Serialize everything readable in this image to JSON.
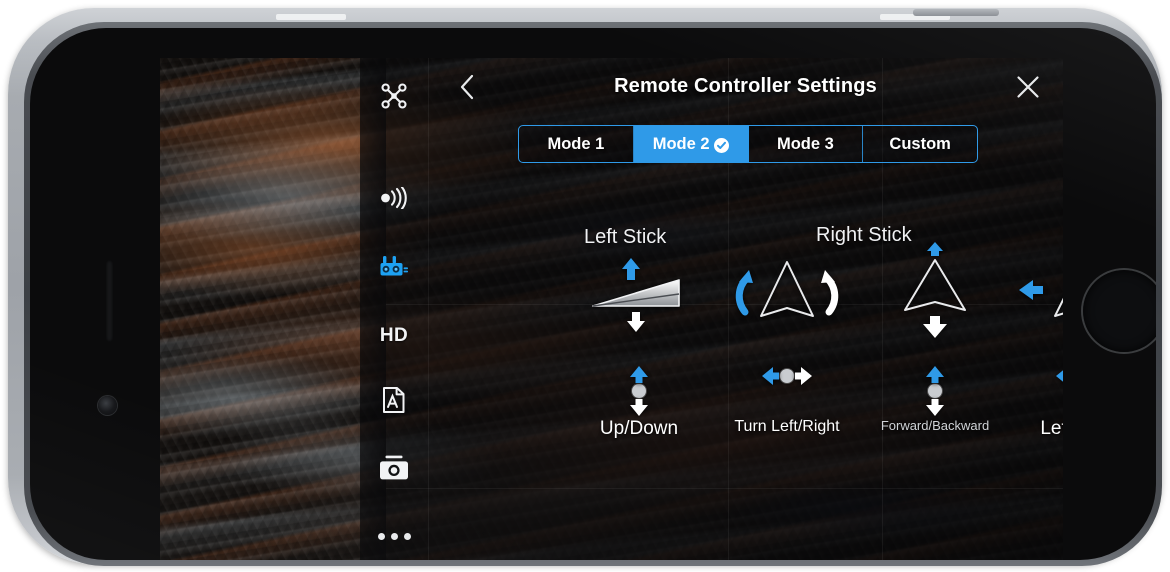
{
  "device": {
    "type": "smartphone",
    "orientation": "landscape"
  },
  "app": {
    "header": {
      "title": "Remote Controller Settings",
      "back_icon": "chevron-left-icon",
      "close_icon": "close-x-icon"
    },
    "sidebar": {
      "items": [
        {
          "id": "aircraft",
          "icon": "drone-icon",
          "label": "",
          "active": false
        },
        {
          "id": "transmission",
          "icon": "signal-broadcast-icon",
          "label": "",
          "active": false
        },
        {
          "id": "remote-controller",
          "icon": "remote-controller-icon",
          "label": "",
          "active": true
        },
        {
          "id": "image-quality",
          "icon": "hd-icon",
          "label": "HD",
          "active": false
        },
        {
          "id": "camera-settings",
          "icon": "exposure-auto-icon",
          "label": "",
          "active": false
        },
        {
          "id": "camera",
          "icon": "camera-icon",
          "label": "",
          "active": false
        },
        {
          "id": "more",
          "icon": "ellipsis-icon",
          "label": "",
          "active": false
        }
      ]
    },
    "tabs": {
      "selected_index": 1,
      "items": [
        {
          "label": "Mode 1",
          "selected": false
        },
        {
          "label": "Mode 2",
          "selected": true,
          "badge_icon": "check-circle-icon"
        },
        {
          "label": "Mode 3",
          "selected": false
        },
        {
          "label": "Custom",
          "selected": false
        }
      ]
    },
    "sticks": [
      {
        "id": "left-stick",
        "heading": "Left Stick",
        "controls": [
          {
            "id": "up-down",
            "label": "Up/Down",
            "label_size": "lg",
            "aircraft_view": "side",
            "axis": "vertical",
            "positive_direction": "up",
            "positive_color": "#2f9ae8",
            "negative_direction": "down",
            "negative_color": "#ffffff"
          },
          {
            "id": "turn-left-right",
            "label": "Turn Left/Right",
            "label_size": "md",
            "aircraft_view": "top",
            "axis": "yaw",
            "positive_direction": "rotate-left",
            "positive_color": "#2f9ae8",
            "negative_direction": "rotate-right",
            "negative_color": "#ffffff"
          }
        ]
      },
      {
        "id": "right-stick",
        "heading": "Right Stick",
        "controls": [
          {
            "id": "forward-backward",
            "label": "Forward/Backward",
            "label_size": "sm",
            "aircraft_view": "top",
            "axis": "vertical",
            "positive_direction": "forward",
            "positive_color": "#2f9ae8",
            "negative_direction": "backward",
            "negative_color": "#ffffff"
          },
          {
            "id": "left-right",
            "label": "Left/Right",
            "label_size": "lg",
            "aircraft_view": "top",
            "axis": "horizontal",
            "positive_direction": "left",
            "positive_color": "#2f9ae8",
            "negative_direction": "right",
            "negative_color": "#ffffff"
          }
        ]
      }
    ],
    "colors": {
      "accent": "#2f9ae8",
      "accent_border": "#2f9ae8",
      "text_primary": "#ffffff",
      "text_muted": "#cfd2d6",
      "knob": "#c9ccd0",
      "scrim": "rgba(8,8,10,0.70)"
    },
    "background": {
      "type": "aerial-photo",
      "subject": "rainbow striped badlands terrain viewed from above"
    }
  }
}
